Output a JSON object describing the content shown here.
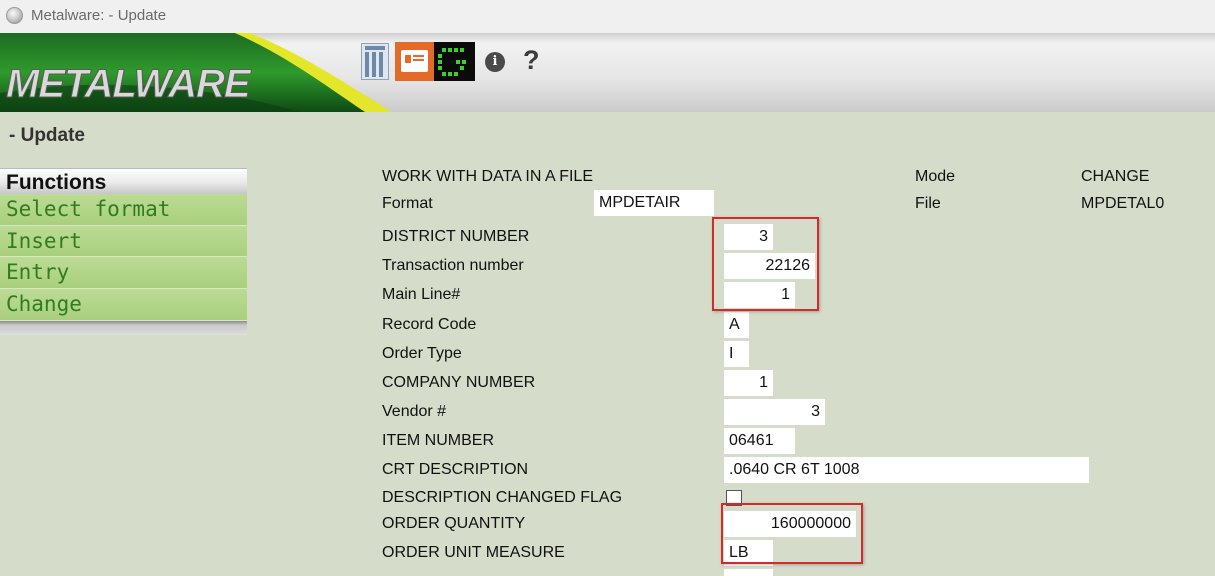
{
  "window": {
    "title": "Metalware: - Update"
  },
  "header": {
    "logo_text": "METALWARE",
    "toolbar_icons": [
      "calculator-icon",
      "presentation-icon",
      "terminal-icon",
      "info-icon",
      "help-icon"
    ]
  },
  "page_heading": "- Update",
  "menu": {
    "title": "Functions",
    "items": [
      {
        "label": "Select format"
      },
      {
        "label": "Insert"
      },
      {
        "label": "Entry"
      },
      {
        "label": "Change"
      }
    ]
  },
  "form": {
    "heading": "WORK WITH DATA IN A FILE",
    "mode_label": "Mode",
    "mode_value": "CHANGE",
    "file_label": "File",
    "file_value": "MPDETAL0",
    "format_label": "Format",
    "format_value": "MPDETAIR",
    "fields": [
      {
        "label": "DISTRICT NUMBER",
        "value": "3"
      },
      {
        "label": "Transaction number",
        "value": "22126"
      },
      {
        "label": "Main Line#",
        "value": "1"
      },
      {
        "label": "Record Code",
        "value": "A"
      },
      {
        "label": "Order Type",
        "value": "I"
      },
      {
        "label": "COMPANY NUMBER",
        "value": "1"
      },
      {
        "label": "Vendor #",
        "value": "3"
      },
      {
        "label": "ITEM NUMBER",
        "value": "06461"
      },
      {
        "label": "CRT DESCRIPTION",
        "value": ".0640 CR 6T  1008"
      },
      {
        "label": "DESCRIPTION CHANGED FLAG",
        "value": ""
      },
      {
        "label": "ORDER QUANTITY",
        "value": "160000000"
      },
      {
        "label": "ORDER UNIT MEASURE",
        "value": "LB"
      }
    ]
  },
  "colors": {
    "background": "#d5ddca",
    "menu_item": "#b3d588",
    "menu_text": "#2f7d1f",
    "highlight_box": "#d42a2a"
  }
}
